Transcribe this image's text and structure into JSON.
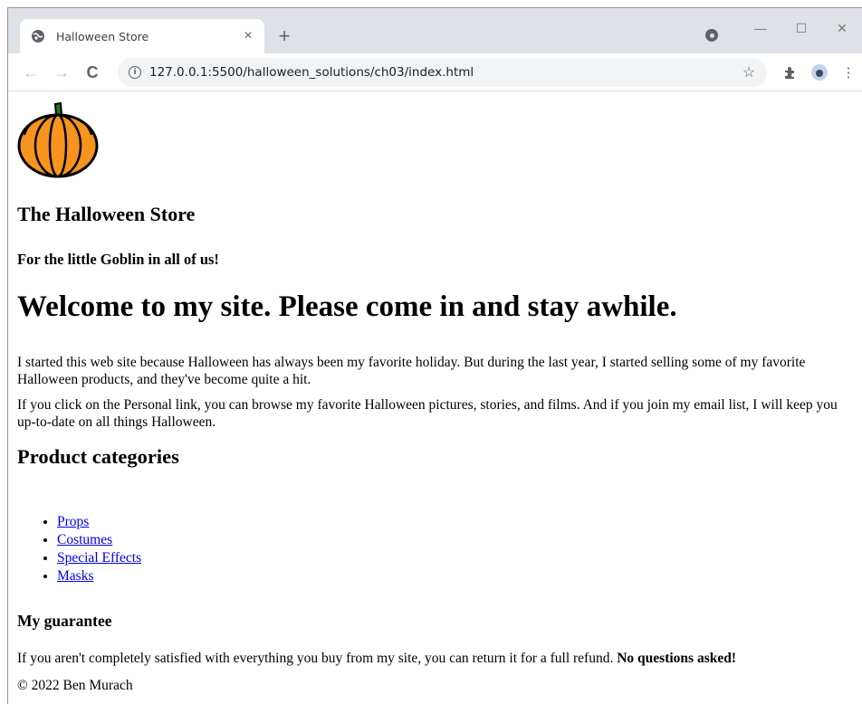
{
  "browser": {
    "tab": {
      "title": "Halloween Store",
      "close": "×"
    },
    "new_tab": "+",
    "window_controls": {
      "minimize": "—",
      "maximize": "☐",
      "close": "✕"
    },
    "nav": {
      "back": "←",
      "forward": "→",
      "reload": "C"
    },
    "url": "127.0.0.1:5500/halloween_solutions/ch03/index.html",
    "icons": [
      "globe-icon",
      "info-icon",
      "star-icon",
      "puzzle-icon",
      "profile-icon",
      "menu-icon"
    ]
  },
  "page": {
    "logo": "pumpkin-icon",
    "store_title": "The Halloween Store",
    "tagline": "For the little Goblin in all of us!",
    "welcome": "Welcome to my site. Please come in and stay awhile.",
    "paragraph1": "I started this web site because Halloween has always been my favorite holiday. But during the last year, I started selling some of my favorite Halloween products, and they've become quite a hit.",
    "paragraph2": "If you click on the Personal link, you can browse my favorite Halloween pictures, stories, and films. And if you join my email list, I will keep you up-to-date on all things Halloween.",
    "categories_heading": "Product categories",
    "categories": [
      "Props",
      "Costumes",
      "Special Effects",
      "Masks"
    ],
    "guarantee_heading": "My guarantee",
    "guarantee_text": "If you aren't completely satisfied with everything you buy from my site, you can return it for a full refund. ",
    "guarantee_bold": "No questions asked!",
    "footer": "© 2022 Ben Murach"
  },
  "colors": {
    "link": "#0000ee",
    "pumpkin": "#f7941d",
    "stem": "#1f7a1f"
  }
}
